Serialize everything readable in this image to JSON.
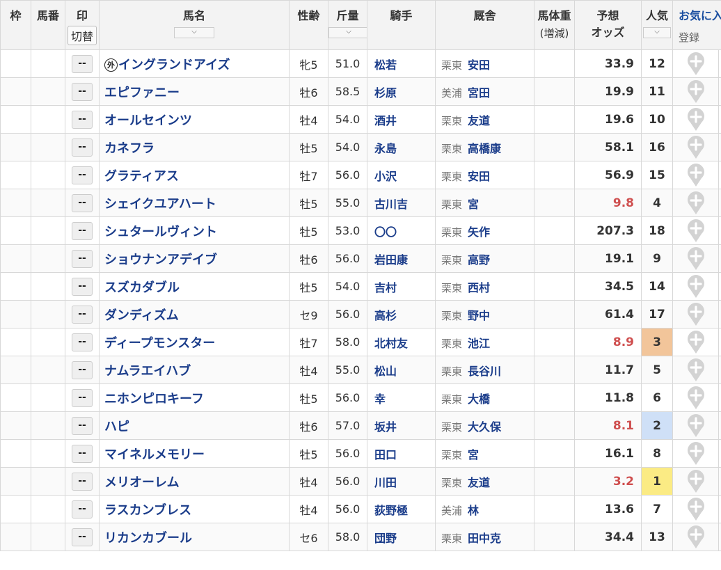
{
  "header": {
    "waku": "枠",
    "umaban": "馬番",
    "mark": "印",
    "switch": "切替",
    "name": "馬名",
    "sexage": "性齢",
    "weight": "斤量",
    "jockey": "騎手",
    "stable": "厩舎",
    "body_weight": "馬体重",
    "body_weight_sub": "(増減)",
    "odds_line1": "予想",
    "odds_line2": "オッズ",
    "popularity": "人気",
    "favorite": "お気に入",
    "register": "登録",
    "sort_arrow": "⌵"
  },
  "mark_label": "--",
  "gaikoku_mark": "外",
  "colors": {
    "name_link": "#1a3c8a",
    "hot_odds": "#cf4f4f",
    "pop1": "#fbeb84",
    "pop2": "#cfe0f7",
    "pop3": "#f2c59a"
  },
  "horses": [
    {
      "gaikoku": true,
      "name": "イングランドアイズ",
      "sexage": "牝5",
      "weight": "51.0",
      "jockey": "松若",
      "region": "栗東",
      "trainer": "安田",
      "odds": "33.9",
      "pop": "12",
      "hot": false
    },
    {
      "gaikoku": false,
      "name": "エピファニー",
      "sexage": "牡6",
      "weight": "58.5",
      "jockey": "杉原",
      "region": "美浦",
      "trainer": "宮田",
      "odds": "19.9",
      "pop": "11",
      "hot": false
    },
    {
      "gaikoku": false,
      "name": "オールセインツ",
      "sexage": "牡4",
      "weight": "54.0",
      "jockey": "酒井",
      "region": "栗東",
      "trainer": "友道",
      "odds": "19.6",
      "pop": "10",
      "hot": false
    },
    {
      "gaikoku": false,
      "name": "カネフラ",
      "sexage": "牡5",
      "weight": "54.0",
      "jockey": "永島",
      "region": "栗東",
      "trainer": "高橋康",
      "odds": "58.1",
      "pop": "16",
      "hot": false
    },
    {
      "gaikoku": false,
      "name": "グラティアス",
      "sexage": "牡7",
      "weight": "56.0",
      "jockey": "小沢",
      "region": "栗東",
      "trainer": "安田",
      "odds": "56.9",
      "pop": "15",
      "hot": false
    },
    {
      "gaikoku": false,
      "name": "シェイクユアハート",
      "sexage": "牡5",
      "weight": "55.0",
      "jockey": "古川吉",
      "region": "栗東",
      "trainer": "宮",
      "odds": "9.8",
      "pop": "4",
      "hot": true
    },
    {
      "gaikoku": false,
      "name": "シュタールヴィント",
      "sexage": "牡5",
      "weight": "53.0",
      "jockey": "〇〇",
      "region": "栗東",
      "trainer": "矢作",
      "odds": "207.3",
      "pop": "18",
      "hot": false
    },
    {
      "gaikoku": false,
      "name": "ショウナンアデイブ",
      "sexage": "牡6",
      "weight": "56.0",
      "jockey": "岩田康",
      "region": "栗東",
      "trainer": "高野",
      "odds": "19.1",
      "pop": "9",
      "hot": false
    },
    {
      "gaikoku": false,
      "name": "スズカダブル",
      "sexage": "牡5",
      "weight": "54.0",
      "jockey": "吉村",
      "region": "栗東",
      "trainer": "西村",
      "odds": "34.5",
      "pop": "14",
      "hot": false
    },
    {
      "gaikoku": false,
      "name": "ダンディズム",
      "sexage": "セ9",
      "weight": "56.0",
      "jockey": "高杉",
      "region": "栗東",
      "trainer": "野中",
      "odds": "61.4",
      "pop": "17",
      "hot": false
    },
    {
      "gaikoku": false,
      "name": "ディープモンスター",
      "sexage": "牡7",
      "weight": "58.0",
      "jockey": "北村友",
      "region": "栗東",
      "trainer": "池江",
      "odds": "8.9",
      "pop": "3",
      "hot": true
    },
    {
      "gaikoku": false,
      "name": "ナムラエイハブ",
      "sexage": "牡4",
      "weight": "55.0",
      "jockey": "松山",
      "region": "栗東",
      "trainer": "長谷川",
      "odds": "11.7",
      "pop": "5",
      "hot": false
    },
    {
      "gaikoku": false,
      "name": "ニホンピロキーフ",
      "sexage": "牡5",
      "weight": "56.0",
      "jockey": "幸",
      "region": "栗東",
      "trainer": "大橋",
      "odds": "11.8",
      "pop": "6",
      "hot": false
    },
    {
      "gaikoku": false,
      "name": "ハピ",
      "sexage": "牡6",
      "weight": "57.0",
      "jockey": "坂井",
      "region": "栗東",
      "trainer": "大久保",
      "odds": "8.1",
      "pop": "2",
      "hot": true
    },
    {
      "gaikoku": false,
      "name": "マイネルメモリー",
      "sexage": "牡5",
      "weight": "56.0",
      "jockey": "田口",
      "region": "栗東",
      "trainer": "宮",
      "odds": "16.1",
      "pop": "8",
      "hot": false
    },
    {
      "gaikoku": false,
      "name": "メリオーレム",
      "sexage": "牡4",
      "weight": "56.0",
      "jockey": "川田",
      "region": "栗東",
      "trainer": "友道",
      "odds": "3.2",
      "pop": "1",
      "hot": true
    },
    {
      "gaikoku": false,
      "name": "ラスカンブレス",
      "sexage": "牡4",
      "weight": "56.0",
      "jockey": "荻野極",
      "region": "美浦",
      "trainer": "林",
      "odds": "13.6",
      "pop": "7",
      "hot": false
    },
    {
      "gaikoku": false,
      "name": "リカンカブール",
      "sexage": "セ6",
      "weight": "58.0",
      "jockey": "団野",
      "region": "栗東",
      "trainer": "田中克",
      "odds": "34.4",
      "pop": "13",
      "hot": false
    }
  ]
}
